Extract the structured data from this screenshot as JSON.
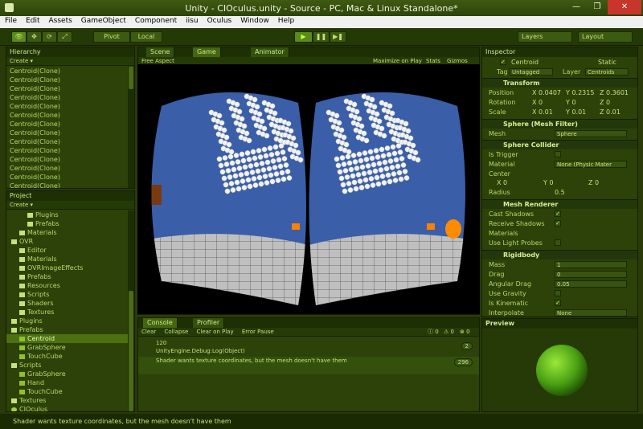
{
  "window": {
    "title": "Unity - CIOculus.unity - Source - PC, Mac & Linux Standalone*"
  },
  "menu": [
    "File",
    "Edit",
    "Assets",
    "GameObject",
    "Component",
    "iisu",
    "Oculus",
    "Window",
    "Help"
  ],
  "toolbar": {
    "pivot": "Pivot",
    "local": "Local",
    "layers": "Layers",
    "layout": "Layout"
  },
  "hierarchy": {
    "tab": "Hierarchy",
    "create": "Create",
    "items": [
      "Centroid(Clone)",
      "Centroid(Clone)",
      "Centroid(Clone)",
      "Centroid(Clone)",
      "Centroid(Clone)",
      "Centroid(Clone)",
      "Centroid(Clone)",
      "Centroid(Clone)",
      "Centroid(Clone)",
      "Centroid(Clone)",
      "Centroid(Clone)",
      "Centroid(Clone)",
      "Centroid(Clone)",
      "Centroid(Clone)",
      "Centroid(Clone)",
      "Centroid(Clone)",
      "Centroid(Clone)"
    ]
  },
  "project": {
    "tab": "Project",
    "create": "Create",
    "items": [
      {
        "label": "Plugins",
        "indent": 2,
        "type": "folder"
      },
      {
        "label": "Prefabs",
        "indent": 2,
        "type": "folder"
      },
      {
        "label": "Materials",
        "indent": 1,
        "type": "folder"
      },
      {
        "label": "OVR",
        "indent": 0,
        "type": "folder"
      },
      {
        "label": "Editor",
        "indent": 1,
        "type": "folder"
      },
      {
        "label": "Materials",
        "indent": 1,
        "type": "folder"
      },
      {
        "label": "OVRImageEffects",
        "indent": 1,
        "type": "folder"
      },
      {
        "label": "Prefabs",
        "indent": 1,
        "type": "folder"
      },
      {
        "label": "Resources",
        "indent": 1,
        "type": "folder"
      },
      {
        "label": "Scripts",
        "indent": 1,
        "type": "folder"
      },
      {
        "label": "Shaders",
        "indent": 1,
        "type": "folder"
      },
      {
        "label": "Textures",
        "indent": 1,
        "type": "folder"
      },
      {
        "label": "Plugins",
        "indent": 0,
        "type": "folder"
      },
      {
        "label": "Prefabs",
        "indent": 0,
        "type": "folder"
      },
      {
        "label": "Centroid",
        "indent": 1,
        "type": "file",
        "selected": true
      },
      {
        "label": "GrabSphere",
        "indent": 1,
        "type": "file"
      },
      {
        "label": "TouchCube",
        "indent": 1,
        "type": "file"
      },
      {
        "label": "Scripts",
        "indent": 0,
        "type": "folder"
      },
      {
        "label": "GrabSphere",
        "indent": 1,
        "type": "file"
      },
      {
        "label": "Hand",
        "indent": 1,
        "type": "file"
      },
      {
        "label": "TouchCube",
        "indent": 1,
        "type": "file"
      },
      {
        "label": "Textures",
        "indent": 0,
        "type": "folder"
      },
      {
        "label": "CIOculus",
        "indent": 0,
        "type": "scene"
      }
    ]
  },
  "scene_tabs": [
    "Scene",
    "Game",
    "Animator"
  ],
  "game_bar": {
    "aspect": "Free Aspect",
    "maximize": "Maximize on Play",
    "stats": "Stats",
    "gizmos": "Gizmos"
  },
  "console": {
    "tabs": [
      "Console",
      "Profiler"
    ],
    "buttons": [
      "Clear",
      "Collapse",
      "Clear on Play",
      "Error Pause"
    ],
    "counts": {
      "messages": "0",
      "warnings": "0",
      "errors": "0"
    },
    "messages": [
      {
        "line1": "120",
        "line2": "UnityEngine.Debug:Log(Object)",
        "badge": "2"
      },
      {
        "line1": "Shader wants texture coordinates, but the mesh  doesn't have them",
        "line2": "",
        "badge": "296"
      }
    ]
  },
  "inspector": {
    "tab": "Inspector",
    "name": "Centroid",
    "static": "Static",
    "tag_label": "Tag",
    "tag": "Untagged",
    "layer_label": "Layer",
    "layer": "Centroids",
    "transform": {
      "title": "Transform",
      "position": "Position",
      "rotation": "Rotation",
      "scale": "Scale",
      "pos": {
        "x": "0.0407",
        "y": "0.2315",
        "z": "0.3601"
      },
      "rot": {
        "x": "0",
        "y": "0",
        "z": "0"
      },
      "scl": {
        "x": "0.01",
        "y": "0.01",
        "z": "0.01"
      }
    },
    "mesh_filter": {
      "title": "Sphere (Mesh Filter)",
      "mesh_label": "Mesh",
      "mesh": "Sphere"
    },
    "sphere_collider": {
      "title": "Sphere Collider",
      "is_trigger": "Is Trigger",
      "material": "Material",
      "material_val": "None (Physic Mater",
      "center": "Center",
      "cx": "0",
      "cy": "0",
      "cz": "0",
      "radius": "Radius",
      "radius_val": "0.5"
    },
    "mesh_renderer": {
      "title": "Mesh Renderer",
      "cast": "Cast Shadows",
      "receive": "Receive Shadows",
      "materials": "Materials",
      "probes": "Use Light Probes"
    },
    "rigidbody": {
      "title": "Rigidbody",
      "mass": "Mass",
      "mass_val": "1",
      "drag": "Drag",
      "drag_val": "0",
      "ang": "Angular Drag",
      "ang_val": "0.05",
      "gravity": "Use Gravity",
      "kinematic": "Is Kinematic",
      "interp": "Interpolate",
      "interp_val": "None"
    },
    "preview": "Preview"
  },
  "status": "Shader wants texture coordinates, but the mesh  doesn't have them"
}
